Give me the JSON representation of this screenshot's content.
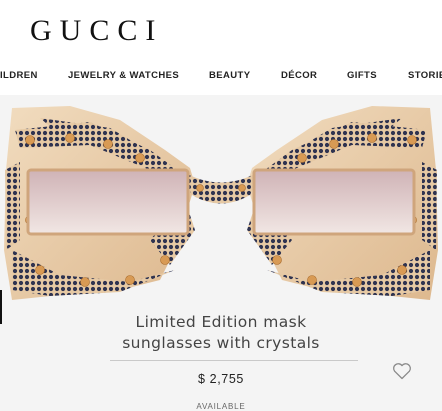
{
  "brand": {
    "logo": "GUCCI"
  },
  "nav": {
    "items": [
      "ILDREN",
      "JEWELRY & WATCHES",
      "BEAUTY",
      "DÉCOR",
      "GIFTS",
      "STORIE"
    ]
  },
  "product": {
    "title_lines": [
      "Limited Edition mask",
      "sunglasses with crystals"
    ],
    "price": "$ 2,755",
    "availability": "AVAILABLE"
  },
  "icons": {
    "wishlist": "heart-outline-icon"
  },
  "colors": {
    "frame_gold": "#e8c9a3",
    "crystal_navy": "#2f3350",
    "crystal_amber": "#d89a54",
    "lens_tint": "#d9bfc0"
  }
}
